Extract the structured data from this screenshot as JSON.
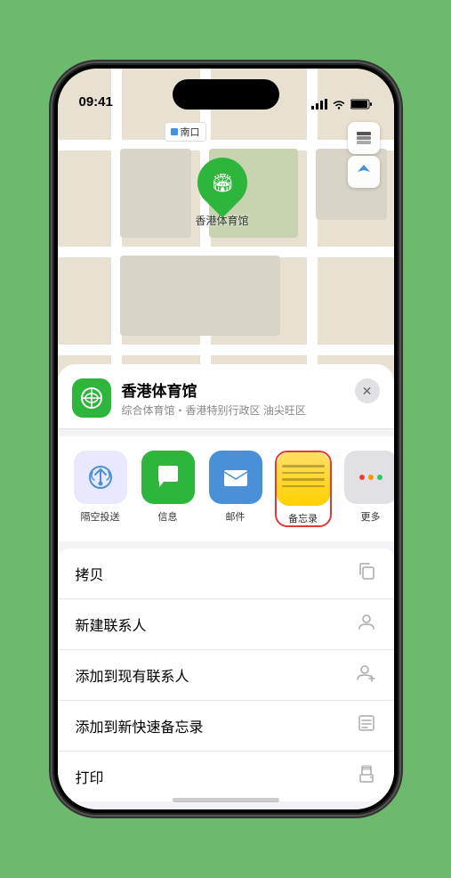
{
  "status_bar": {
    "time": "09:41",
    "location_arrow": "▲"
  },
  "map": {
    "tag_label": "南口",
    "pin_label": "香港体育馆"
  },
  "location_header": {
    "name": "香港体育馆",
    "description": "综合体育馆・香港特别行政区 油尖旺区",
    "close_label": "✕"
  },
  "share_items": [
    {
      "id": "airdrop",
      "label": "隔空投送",
      "icon": "airdrop"
    },
    {
      "id": "message",
      "label": "信息",
      "icon": "message"
    },
    {
      "id": "mail",
      "label": "邮件",
      "icon": "mail"
    },
    {
      "id": "notes",
      "label": "备忘录",
      "icon": "notes"
    },
    {
      "id": "more",
      "label": "更多",
      "icon": "more"
    }
  ],
  "actions": [
    {
      "id": "copy",
      "label": "拷贝",
      "icon": "📋"
    },
    {
      "id": "new-contact",
      "label": "新建联系人",
      "icon": "👤"
    },
    {
      "id": "add-existing",
      "label": "添加到现有联系人",
      "icon": "👤+"
    },
    {
      "id": "add-notes",
      "label": "添加到新快速备忘录",
      "icon": "📝"
    },
    {
      "id": "print",
      "label": "打印",
      "icon": "🖨"
    }
  ],
  "colors": {
    "green": "#2db53c",
    "red_border": "#e53935",
    "airdrop_bg": "#4a90d9",
    "message_bg": "#2db53c",
    "mail_bg": "#4a90d9",
    "notes_bg_top": "#ffe066",
    "notes_bg_bottom": "#ffd000"
  }
}
